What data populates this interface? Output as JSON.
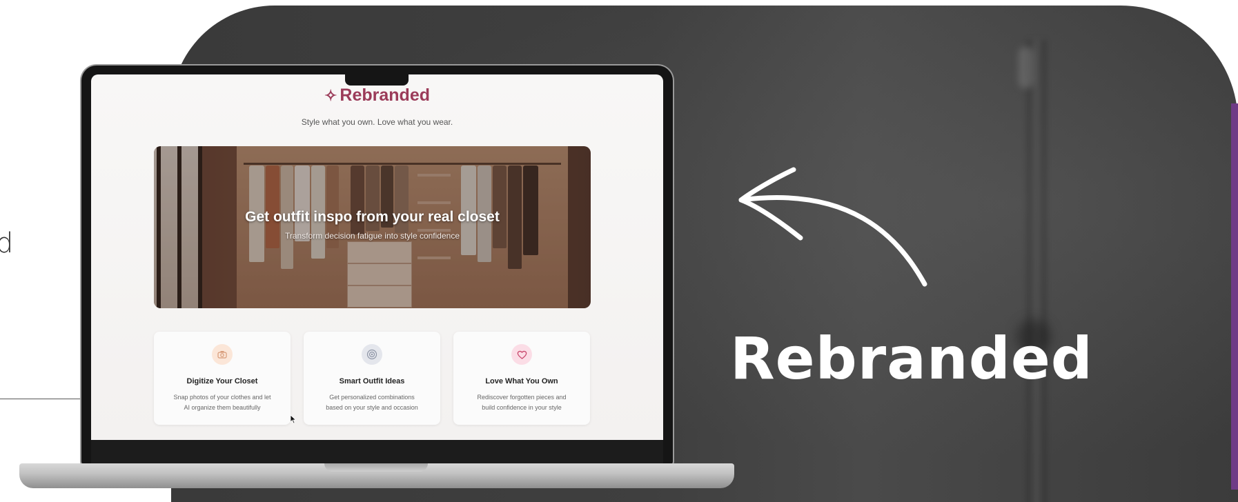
{
  "left_edge": {
    "partial_text": "d"
  },
  "overlay": {
    "brand_text": "Rebranded"
  },
  "app": {
    "title": "Rebranded",
    "sparkle_icon": "sparkle-icon",
    "tagline": "Style what you own. Love what you wear.",
    "hero": {
      "title": "Get outfit inspo from your real closet",
      "subtitle": "Transform decision fatigue into style confidence"
    },
    "cards": [
      {
        "icon": "camera-icon",
        "title": "Digitize Your Closet",
        "desc_line1": "Snap photos of your clothes and let",
        "desc_line2": "AI organize them beautifully"
      },
      {
        "icon": "target-icon",
        "title": "Smart Outfit Ideas",
        "desc_line1": "Get personalized combinations",
        "desc_line2": "based on your style and occasion"
      },
      {
        "icon": "heart-icon",
        "title": "Love What You Own",
        "desc_line1": "Rediscover forgotten pieces and",
        "desc_line2": "build confidence in your style"
      }
    ]
  },
  "colors": {
    "brand": "#9b3b59",
    "panel": "#3f3f3f",
    "accent_strip": "#6f3b86",
    "card1_icon_bg": "#fbe6d8",
    "card2_icon_bg": "#e4e6ec",
    "card3_icon_bg": "#fbdde6"
  }
}
